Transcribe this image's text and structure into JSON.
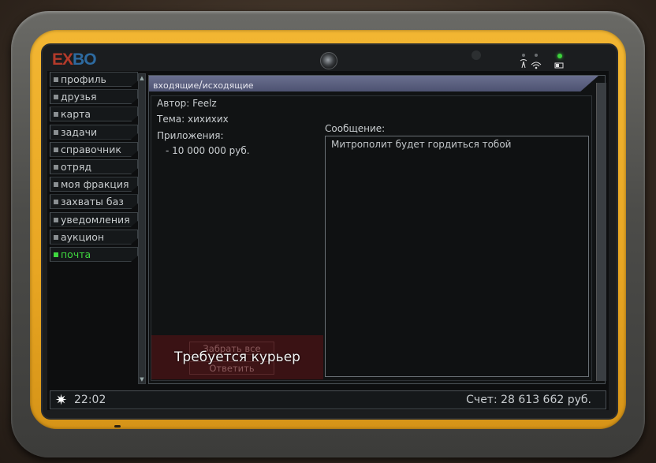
{
  "device": {
    "logo_left": "E",
    "logo_mid": "X",
    "logo_right": "BO"
  },
  "sidebar": {
    "items": [
      {
        "label": "профиль",
        "active": false
      },
      {
        "label": "друзья",
        "active": false
      },
      {
        "label": "карта",
        "active": false
      },
      {
        "label": "задачи",
        "active": false
      },
      {
        "label": "справочник",
        "active": false
      },
      {
        "label": "отряд",
        "active": false
      },
      {
        "label": "моя фракция",
        "active": false
      },
      {
        "label": "захваты баз",
        "active": false
      },
      {
        "label": "уведомления",
        "active": false
      },
      {
        "label": "аукцион",
        "active": false
      },
      {
        "label": "почта",
        "active": true
      }
    ]
  },
  "mail": {
    "tab_incoming": "входящие",
    "tab_separator": "/",
    "tab_outgoing": "исходящие",
    "author": "Автор: Feelz",
    "subject": "Тема: хихихих",
    "attachments_label": "Приложения:",
    "attachment_item": "- 10 000 000 руб.",
    "message_label": "Сообщение:",
    "message_text": "Митрополит будет гордиться тобой",
    "take_all_label": "Забрать все",
    "reply_label": "Ответить",
    "courier_required": "Требуется курьер"
  },
  "status_bar": {
    "time": "22:02",
    "balance": "Счет: 28 613 662 руб."
  },
  "colors": {
    "active_nav": "#3fd83f",
    "bezel": "#e8a623",
    "tab_bar": "#5a5f80",
    "action_panel": "#3a1214"
  }
}
